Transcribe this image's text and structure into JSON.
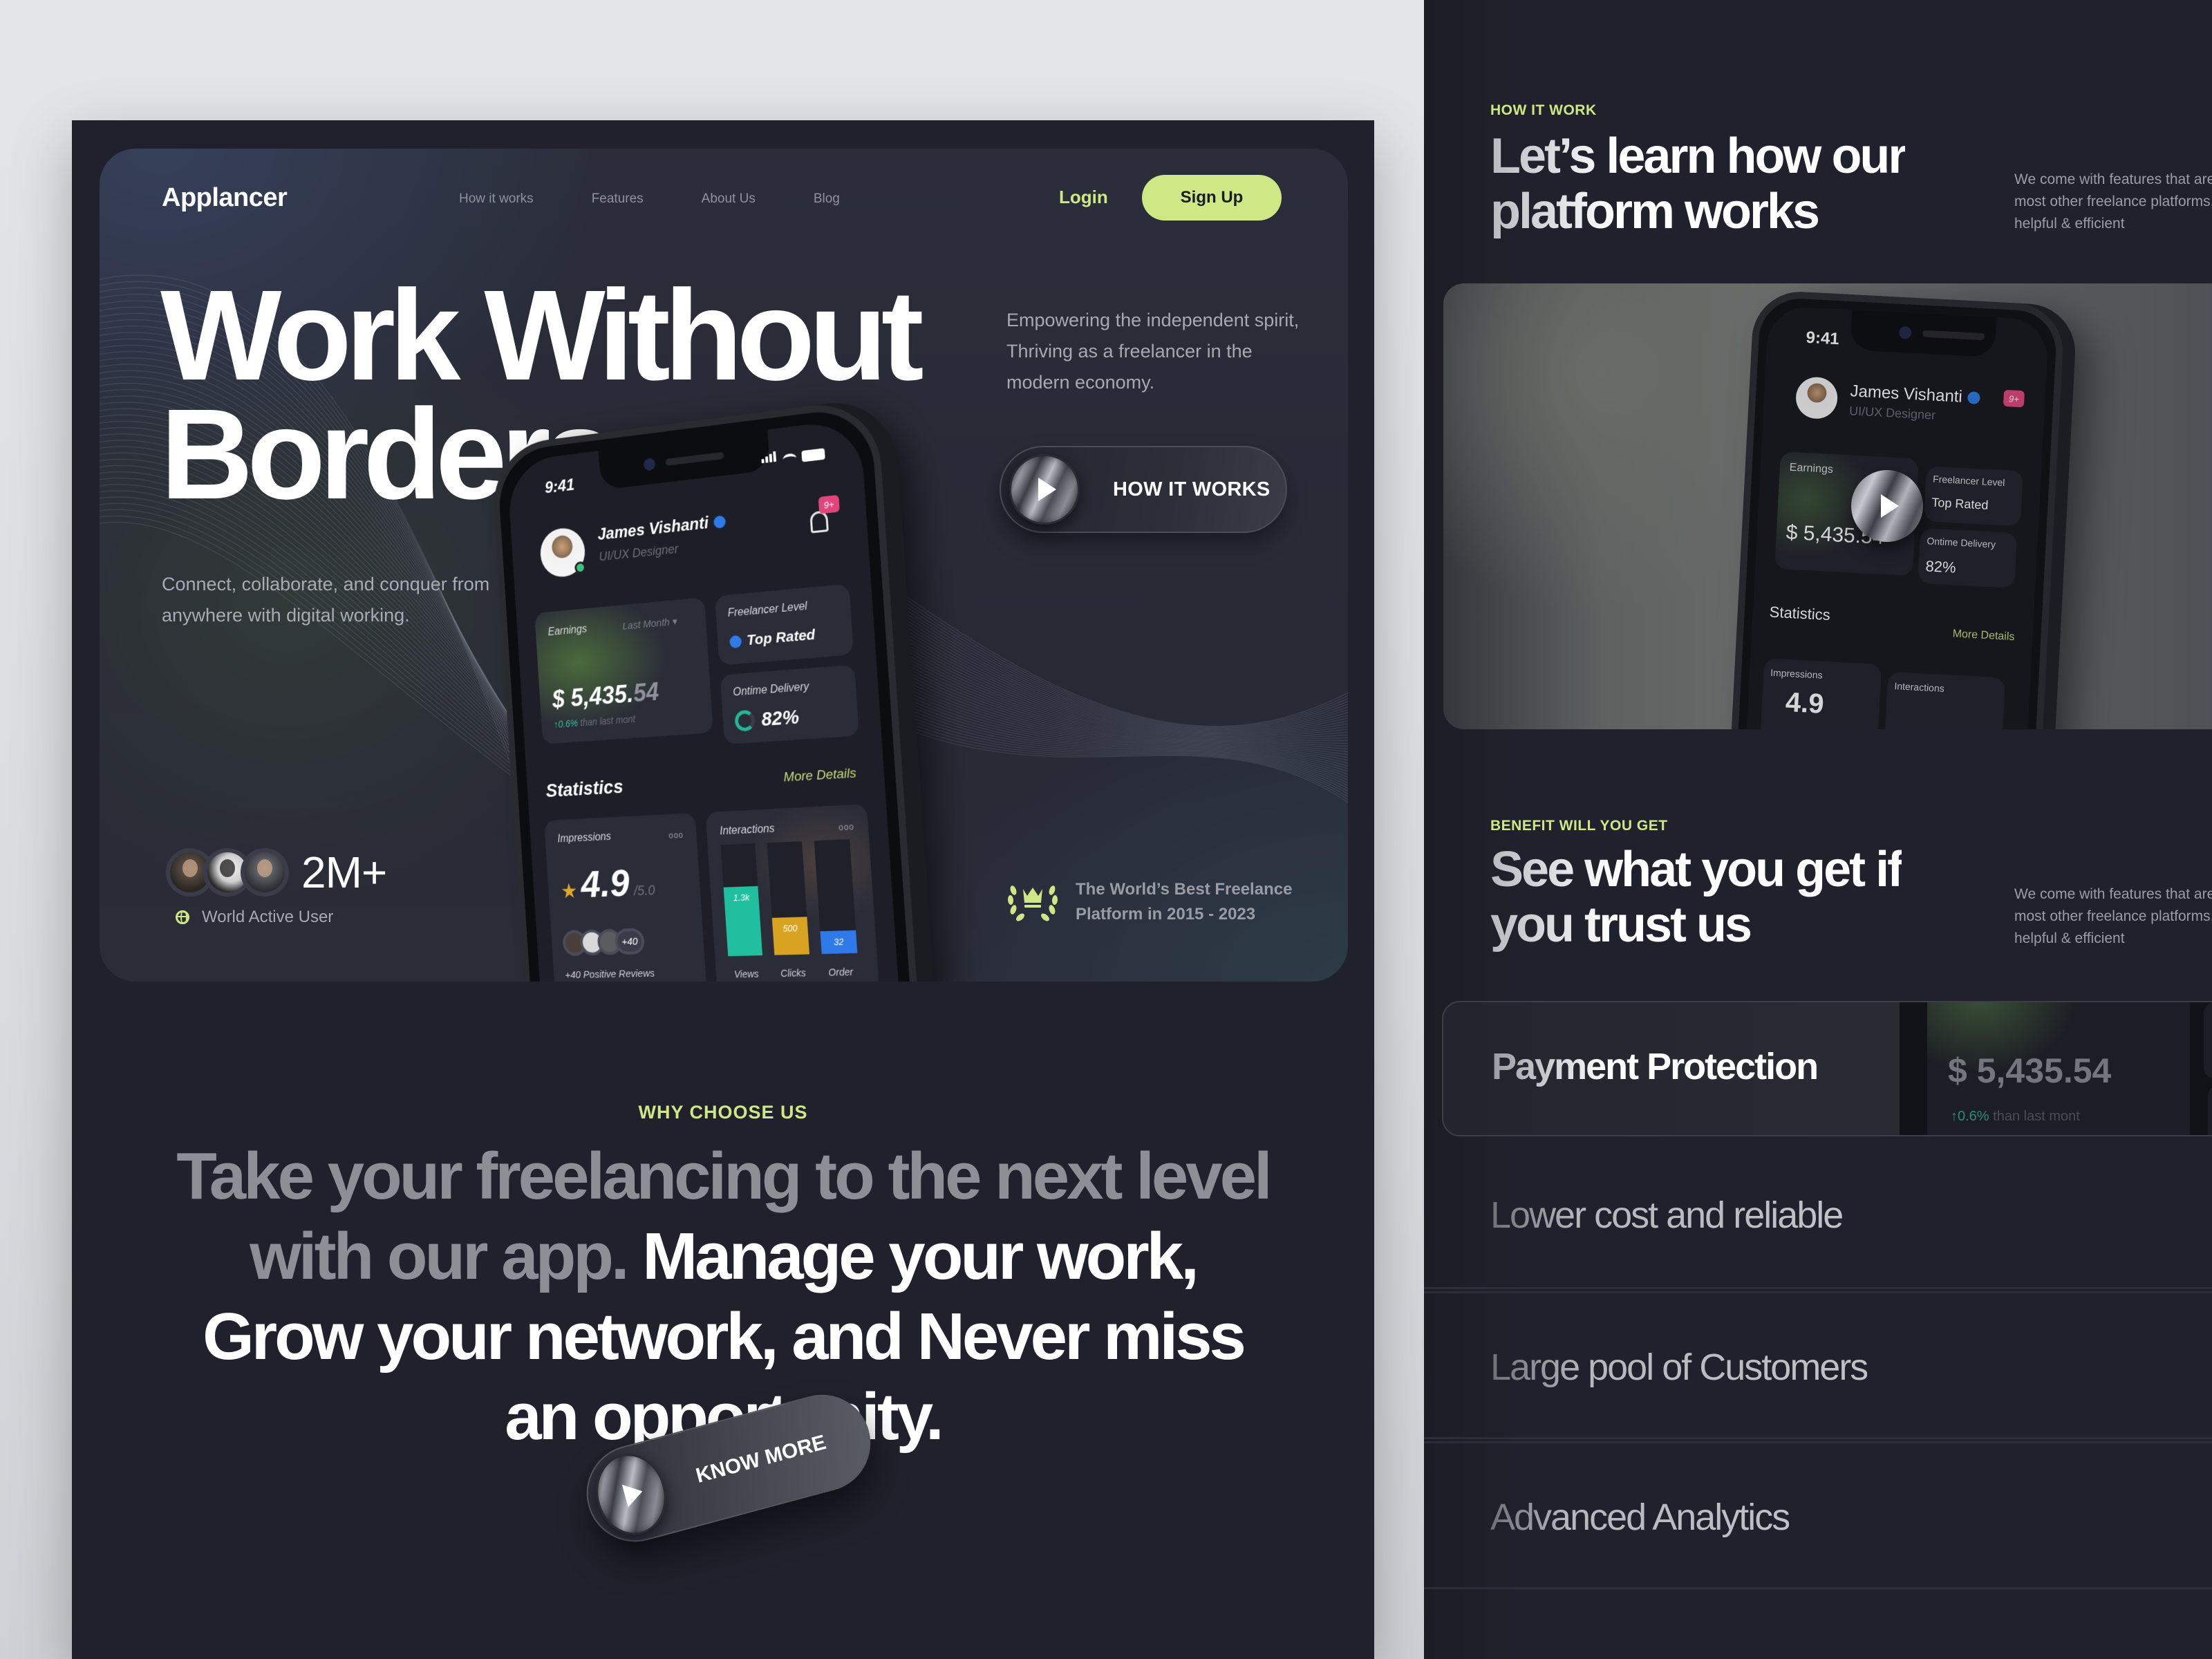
{
  "nav": {
    "logo": "Applancer",
    "links": [
      "How it works",
      "Features",
      "About Us",
      "Blog"
    ],
    "login": "Login",
    "signup": "Sign Up"
  },
  "hero": {
    "title_line1": "Work Without",
    "title_line2": "Borders",
    "subtitle": "Connect, collaborate, and conquer from anywhere with digital working.",
    "right_text": "Empowering the independent spirit, Thriving as a freelancer in the modern economy.",
    "cta_label": "HOW IT WORKS",
    "users_count": "2M+",
    "users_label": "World Active User",
    "award_line1": "The World’s Best Freelance",
    "award_line2": "Platform in 2015 - 2023"
  },
  "phone": {
    "time": "9:41",
    "user_name": "James Vishanti",
    "user_role": "UI/UX Designer",
    "notification_badge": "9+",
    "earnings_label": "Earnings",
    "earnings_period": "Last Month",
    "earnings_value_main": "$ 5,435.",
    "earnings_value_cents": "54",
    "earnings_change": "↑0.6%",
    "earnings_change_note": "than last mont",
    "level_label": "Freelancer Level",
    "level_value": "Top Rated",
    "delivery_label": "Ontime Delivery",
    "delivery_value": "82%",
    "delivery_fraction": 0.82,
    "statistics_title": "Statistics",
    "more_details": "More Details",
    "impressions_label": "Impressions",
    "rating": "4.9",
    "rating_max": "/5.0",
    "reviews_more": "+40",
    "reviews_label": "+40 Positive Reviews",
    "interactions_label": "Interactions",
    "more_dots": "ooo",
    "bars": [
      {
        "label": "Views",
        "value_label": "1.3k",
        "fraction": 0.62,
        "color": "#1fbf9f"
      },
      {
        "label": "Clicks",
        "value_label": "500",
        "fraction": 0.33,
        "color": "#d9a322"
      },
      {
        "label": "Order",
        "value_label": "32",
        "fraction": 0.2,
        "color": "#2f79e8"
      }
    ]
  },
  "why": {
    "label": "WHY CHOOSE US",
    "text_muted": "Take your freelancing to the next level with our app. ",
    "text_bright": "Manage your work, Grow your network, and Never miss an opportunity.",
    "cta_label": "KNOW MORE"
  },
  "how_it_work": {
    "label": "HOW IT WORK",
    "title_line1": "Let’s learn how our",
    "title_line2": "platform works",
    "desc_line1": "We come with features that are c",
    "desc_line2": "most other freelance platforms, t",
    "desc_line3": "helpful & efficient"
  },
  "benefits": {
    "label": "BENEFIT WILL YOU GET",
    "title_line1": "See what you get if",
    "title_line2": "you trust us",
    "desc_line1": "We come with features that are c",
    "desc_line2": "most other freelance platforms, t",
    "desc_line3": "helpful & efficient",
    "active_item": "Payment Protection",
    "active_preview_value": "$ 5,435.54",
    "active_preview_change": "↑0.6%",
    "active_preview_note": "than last mont",
    "items": [
      "Lower cost and reliable",
      "Large pool of Customers",
      "Advanced Analytics"
    ]
  },
  "colors": {
    "accent": "#cde884",
    "panel_bg": "#20212c",
    "page_bg": "#e3e5e9",
    "badge": "#e0467c",
    "verified": "#2f79e8",
    "success": "#36c19c"
  }
}
